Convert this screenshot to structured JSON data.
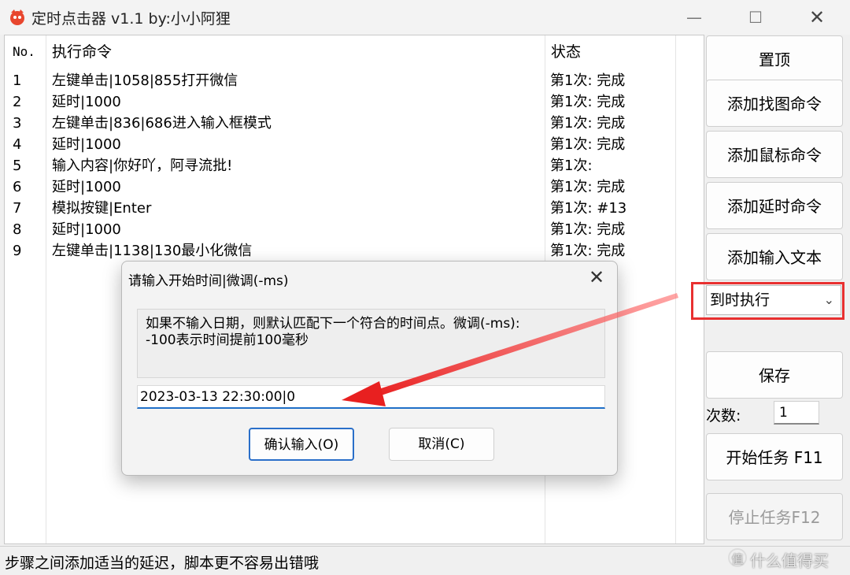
{
  "window": {
    "title": "定时点击器 v1.1 by:小小阿狸",
    "min_icon": "minimize-icon",
    "max_icon": "maximize-icon",
    "close_icon": "close-icon",
    "min_glyph": "—",
    "max_glyph": "☐",
    "close_glyph": "✕"
  },
  "table": {
    "headers": {
      "no": "No.",
      "command": "执行命令",
      "status": "状态"
    },
    "rows": [
      {
        "no": "1",
        "command": "左键单击|1058|855打开微信",
        "status": "第1次: 完成"
      },
      {
        "no": "2",
        "command": "延时|1000",
        "status": "第1次: 完成"
      },
      {
        "no": "3",
        "command": "左键单击|836|686进入输入框模式",
        "status": "第1次: 完成"
      },
      {
        "no": "4",
        "command": "延时|1000",
        "status": "第1次: 完成"
      },
      {
        "no": "5",
        "command": "输入内容|你好吖，阿寻流批!",
        "status": "第1次:"
      },
      {
        "no": "6",
        "command": "延时|1000",
        "status": "第1次: 完成"
      },
      {
        "no": "7",
        "command": "模拟按键|Enter",
        "status": "第1次: #13"
      },
      {
        "no": "8",
        "command": "延时|1000",
        "status": "第1次: 完成"
      },
      {
        "no": "9",
        "command": "左键单击|1138|130最小化微信",
        "status": "第1次: 完成"
      }
    ]
  },
  "side": {
    "pin_top": "置顶",
    "add_image": "添加找图命令",
    "add_mouse": "添加鼠标命令",
    "add_delay": "添加延时命令",
    "add_text": "添加输入文本",
    "mode_selected": "到时执行",
    "mode_icon": "chevron-down-icon",
    "save": "保存",
    "count_label": "次数:",
    "count_value": "1",
    "start": "开始任务 F11",
    "stop": "停止任务F12"
  },
  "statusbar": {
    "text": "步骤之间添加适当的延迟，脚本更不容易出错哦",
    "watermark": "什么值得买",
    "watermark_glyph": "值"
  },
  "dialog": {
    "title": "请输入开始时间|微调(-ms)",
    "message_line1": "如果不输入日期，则默认匹配下一个符合的时间点。微调(-ms):",
    "message_line2": "-100表示时间提前100毫秒",
    "input_value": "2023-03-13 22:30:00|0",
    "ok": "确认输入(O)",
    "cancel": "取消(C)",
    "close_glyph": "✕"
  },
  "colors": {
    "highlight_red": "#e83030",
    "focus_blue": "#1f6fc8"
  }
}
